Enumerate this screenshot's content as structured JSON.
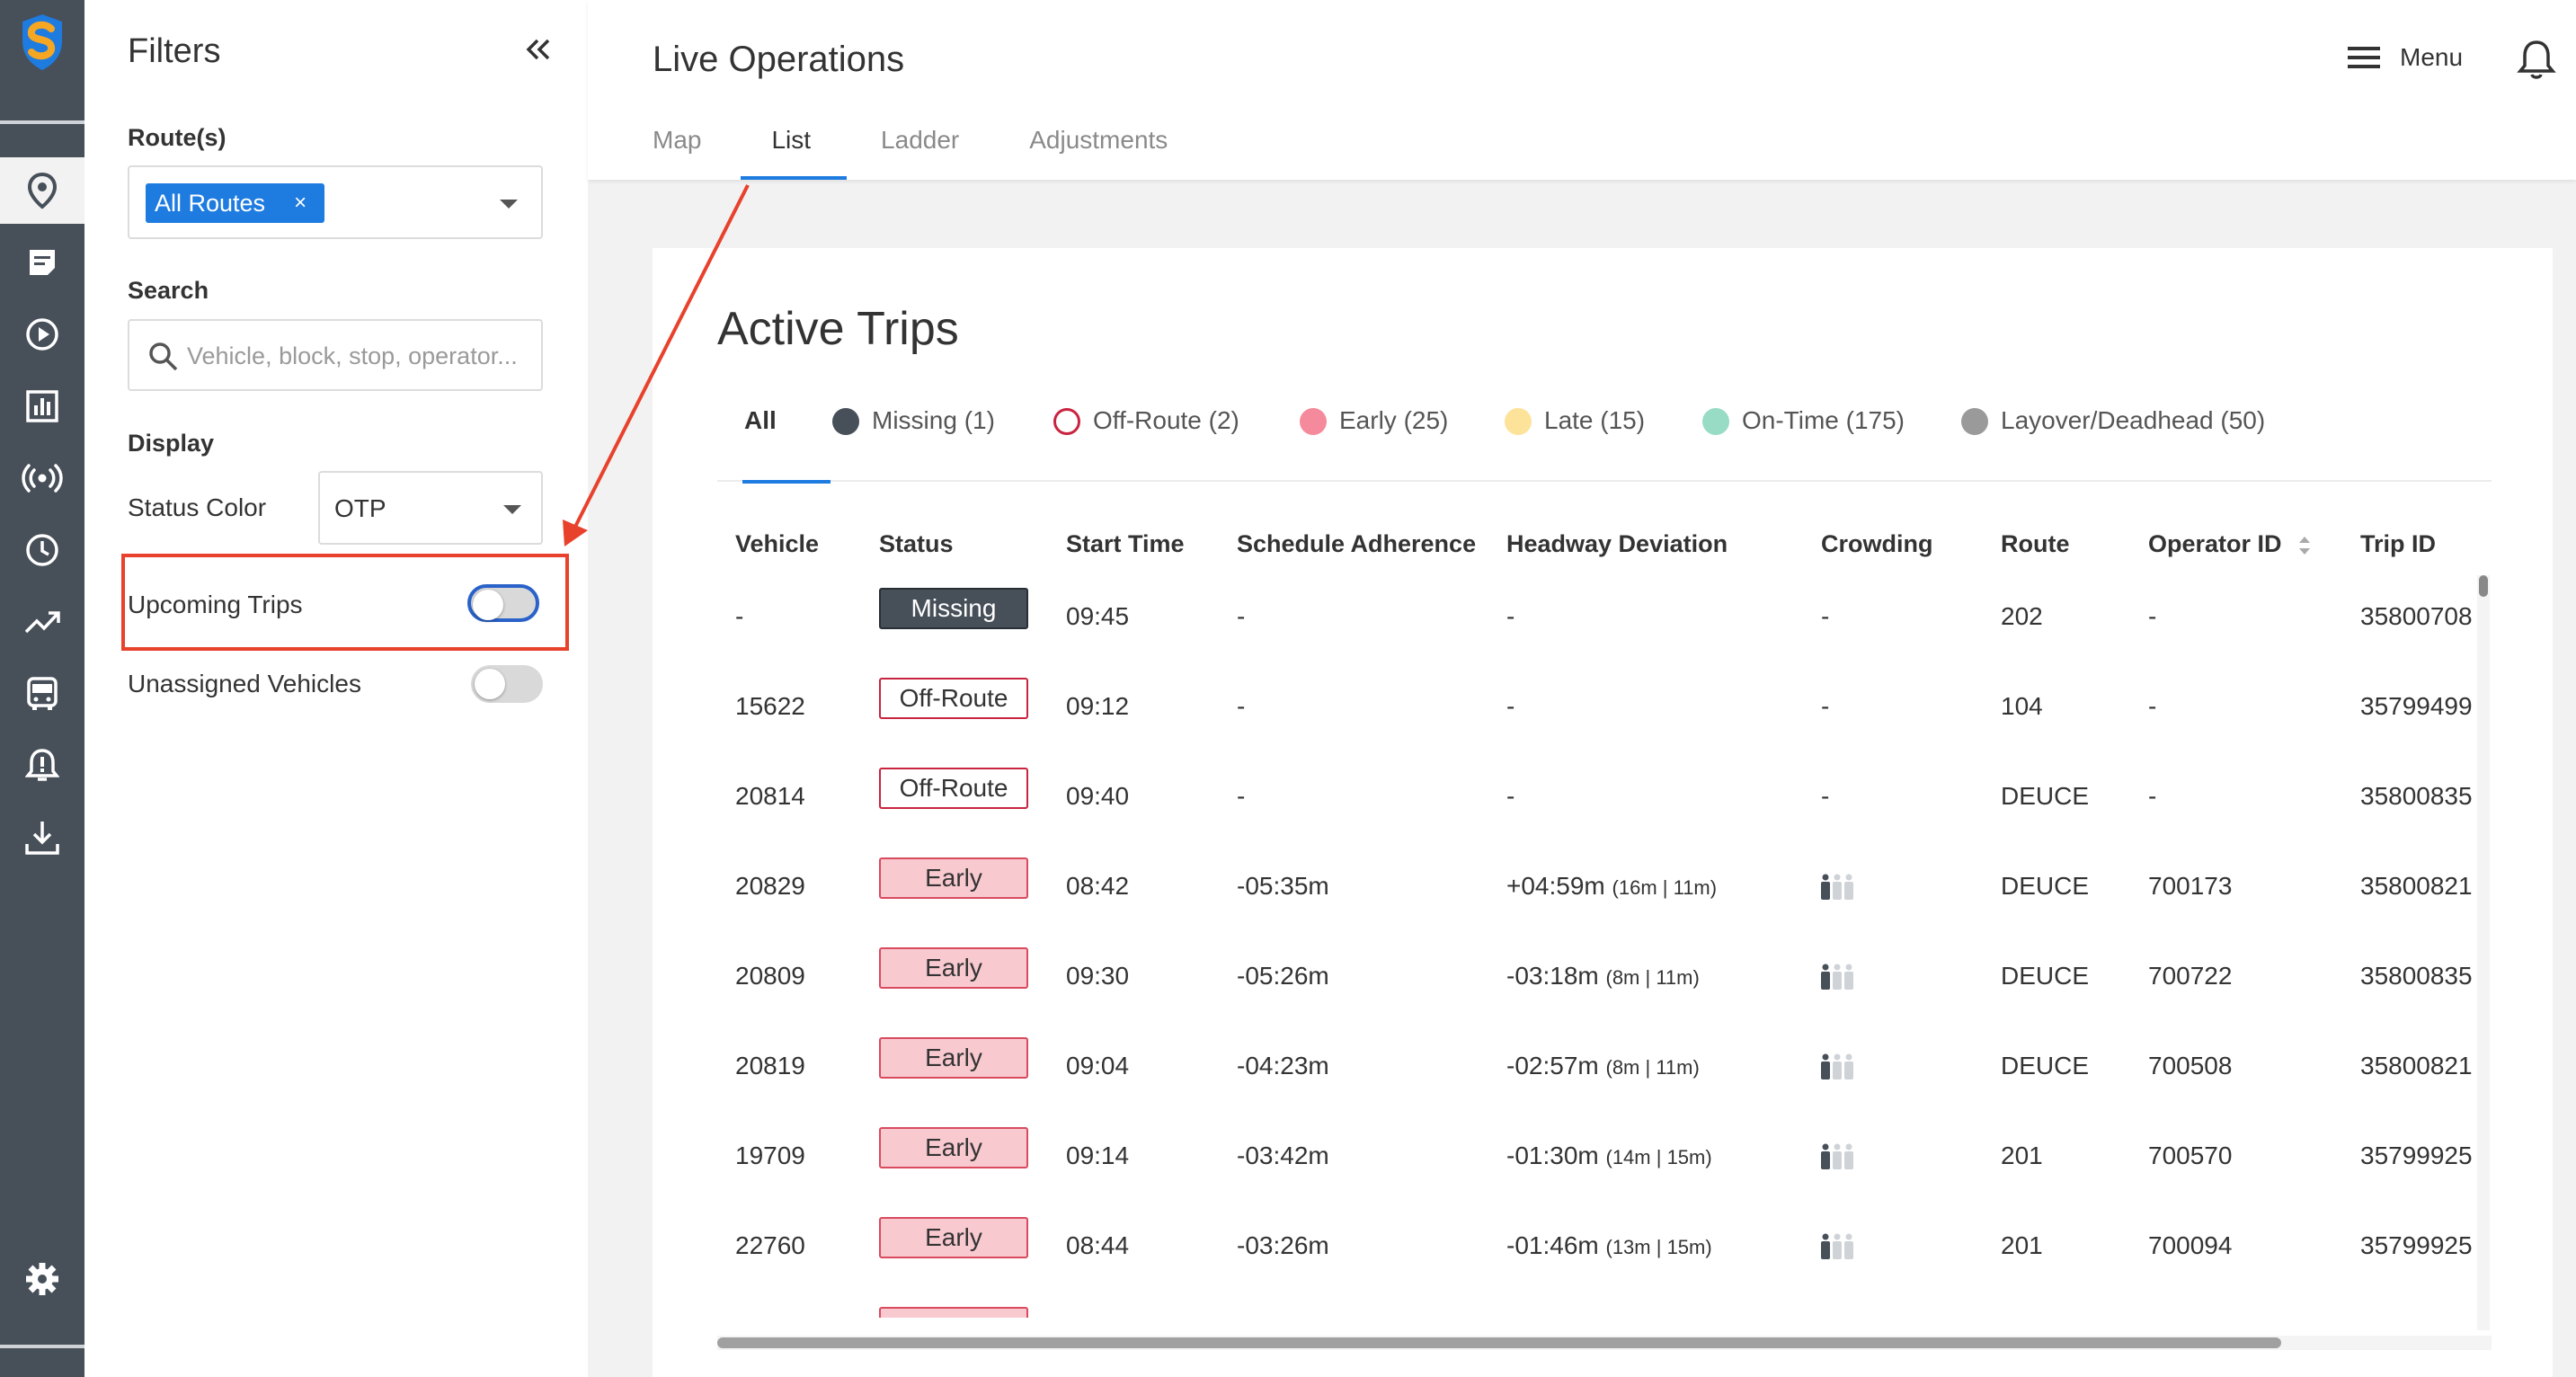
{
  "sidebar": {
    "active_item": "live-operations",
    "items": [
      {
        "name": "map-pin-icon"
      },
      {
        "name": "notes-icon"
      },
      {
        "name": "play-icon"
      },
      {
        "name": "bar-chart-icon"
      },
      {
        "name": "broadcast-icon"
      },
      {
        "name": "clock-icon"
      },
      {
        "name": "trend-icon"
      },
      {
        "name": "bus-icon"
      },
      {
        "name": "alert-bell-icon"
      },
      {
        "name": "download-icon"
      }
    ],
    "settings_icon": "gear-icon"
  },
  "filters": {
    "title": "Filters",
    "routes_label": "Route(s)",
    "routes_chip": "All Routes",
    "chip_remove": "×",
    "search_label": "Search",
    "search_placeholder": "Vehicle, block, stop, operator...",
    "display_label": "Display",
    "status_color_label": "Status Color",
    "status_color_value": "OTP",
    "upcoming_trips_label": "Upcoming Trips",
    "upcoming_trips_on": false,
    "unassigned_vehicles_label": "Unassigned Vehicles",
    "unassigned_vehicles_on": false
  },
  "header": {
    "title": "Live Operations",
    "tabs": [
      {
        "label": "Map",
        "active": false
      },
      {
        "label": "List",
        "active": true
      },
      {
        "label": "Ladder",
        "active": false
      },
      {
        "label": "Adjustments",
        "active": false
      }
    ],
    "menu_label": "Menu"
  },
  "trips": {
    "title": "Active Trips",
    "filter_tabs": [
      {
        "label": "All",
        "color": ""
      },
      {
        "label": "Missing (1)",
        "color": "#474f59"
      },
      {
        "label": "Off-Route (2)",
        "color": "#c9243f"
      },
      {
        "label": "Early (25)",
        "color": "#f48a9b"
      },
      {
        "label": "Late (15)",
        "color": "#fde29a"
      },
      {
        "label": "On-Time (175)",
        "color": "#98dcc6"
      },
      {
        "label": "Layover/Deadhead (50)",
        "color": "#9a9a9a"
      }
    ],
    "columns": [
      "Vehicle",
      "Status",
      "Start Time",
      "Schedule Adherence",
      "Headway Deviation",
      "Crowding",
      "Route",
      "Operator ID",
      "Trip ID"
    ],
    "rows": [
      {
        "vehicle": "-",
        "status": "Missing",
        "start": "09:45",
        "adherence": "-",
        "headway": "-",
        "headway_detail": "",
        "crowding": "-",
        "route": "202",
        "operator": "-",
        "trip": "35800708"
      },
      {
        "vehicle": "15622",
        "status": "Off-Route",
        "start": "09:12",
        "adherence": "-",
        "headway": "-",
        "headway_detail": "",
        "crowding": "-",
        "route": "104",
        "operator": "-",
        "trip": "35799499"
      },
      {
        "vehicle": "20814",
        "status": "Off-Route",
        "start": "09:40",
        "adherence": "-",
        "headway": "-",
        "headway_detail": "",
        "crowding": "-",
        "route": "DEUCE",
        "operator": "-",
        "trip": "35800835"
      },
      {
        "vehicle": "20829",
        "status": "Early",
        "start": "08:42",
        "adherence": "-05:35m",
        "headway": "+04:59m",
        "headway_detail": "(16m | 11m)",
        "crowding": "icon",
        "route": "DEUCE",
        "operator": "700173",
        "trip": "35800821"
      },
      {
        "vehicle": "20809",
        "status": "Early",
        "start": "09:30",
        "adherence": "-05:26m",
        "headway": "-03:18m",
        "headway_detail": "(8m | 11m)",
        "crowding": "icon",
        "route": "DEUCE",
        "operator": "700722",
        "trip": "35800835"
      },
      {
        "vehicle": "20819",
        "status": "Early",
        "start": "09:04",
        "adherence": "-04:23m",
        "headway": "-02:57m",
        "headway_detail": "(8m | 11m)",
        "crowding": "icon",
        "route": "DEUCE",
        "operator": "700508",
        "trip": "35800821"
      },
      {
        "vehicle": "19709",
        "status": "Early",
        "start": "09:14",
        "adherence": "-03:42m",
        "headway": "-01:30m",
        "headway_detail": "(14m | 15m)",
        "crowding": "icon",
        "route": "201",
        "operator": "700570",
        "trip": "35799925"
      },
      {
        "vehicle": "22760",
        "status": "Early",
        "start": "08:44",
        "adherence": "-03:26m",
        "headway": "-01:46m",
        "headway_detail": "(13m | 15m)",
        "crowding": "icon",
        "route": "201",
        "operator": "700094",
        "trip": "35799925"
      }
    ]
  },
  "colors": {
    "accent": "#1e7be0",
    "annotation": "#e8412c",
    "rail": "#474f59"
  }
}
